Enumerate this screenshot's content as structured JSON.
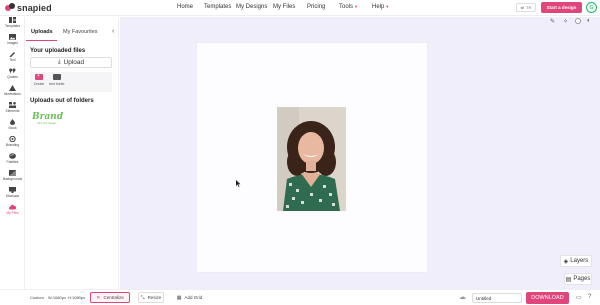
{
  "brand": {
    "name": "snapied",
    "colors": {
      "accent": "#e0457b",
      "canvas_bg": "#f1eefb",
      "success": "#2bb673"
    }
  },
  "header": {
    "nav": [
      {
        "label": "Home"
      },
      {
        "label": "Templates"
      },
      {
        "label": "My Designs"
      },
      {
        "label": "My Files"
      },
      {
        "label": "Pricing"
      },
      {
        "label": "Tools"
      },
      {
        "label": "Help"
      }
    ],
    "lang_label": "TR",
    "start_label": "Start a design",
    "avatar_initial": "G"
  },
  "rail": {
    "items": [
      {
        "label": "Templates",
        "icon": "template-icon"
      },
      {
        "label": "Images",
        "icon": "image-icon"
      },
      {
        "label": "Text",
        "icon": "pen-icon"
      },
      {
        "label": "Quotes",
        "icon": "quote-icon"
      },
      {
        "label": "Illustrations",
        "icon": "illustration-icon"
      },
      {
        "label": "Elements",
        "icon": "elements-icon"
      },
      {
        "label": "Stock",
        "icon": "drop-icon"
      },
      {
        "label": "Branding",
        "icon": "branding-icon"
      },
      {
        "label": "Palettes",
        "icon": "palette-icon"
      },
      {
        "label": "Backgrounds",
        "icon": "background-icon"
      },
      {
        "label": "Mockups",
        "icon": "mockup-icon"
      },
      {
        "label": "My Files",
        "icon": "cloud-icon"
      }
    ]
  },
  "panel": {
    "tabs": [
      {
        "label": "Uploads"
      },
      {
        "label": "My Favourites"
      }
    ],
    "uploaded_title": "Your uploaded files",
    "upload_label": "Upload",
    "folders": [
      {
        "label": "Create"
      },
      {
        "label": "test folder"
      }
    ],
    "out_of_folders_title": "Uploads out of folders",
    "brand_logo": {
      "main": "Brand",
      "sub": "Add Your Slogan"
    }
  },
  "workspace": {
    "layers_label": "Layers",
    "pages_label": "Pages",
    "tool_icons": [
      "brush-icon",
      "magic-icon",
      "shape-icon",
      "contrast-icon"
    ]
  },
  "bottom": {
    "size_label": "Custom",
    "width_value": "W:1080px",
    "height_value": "H:1080px",
    "centralize_label": "Centralize",
    "resize_label": "Resize",
    "add_grid_label": "Add Grid",
    "title_value": "Untitled",
    "download_label": "DOWNLOAD"
  }
}
